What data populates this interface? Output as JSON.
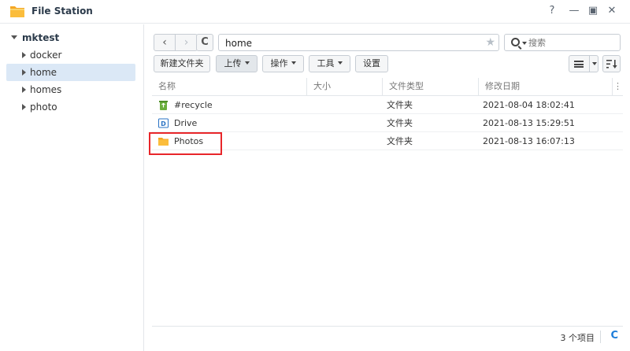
{
  "window": {
    "title": "File Station",
    "controls": [
      "?",
      "—",
      "▣",
      "✕"
    ]
  },
  "sidebar": {
    "root": "mktest",
    "items": [
      {
        "label": "docker",
        "selected": false
      },
      {
        "label": "home",
        "selected": true
      },
      {
        "label": "homes",
        "selected": false
      },
      {
        "label": "photo",
        "selected": false
      }
    ]
  },
  "nav": {
    "back": "‹",
    "forward": "›",
    "refresh": "C",
    "path": "home",
    "star": "★",
    "search_placeholder": "搜索"
  },
  "toolbar": {
    "new_folder": "新建文件夹",
    "upload": "上传",
    "action": "操作",
    "tools": "工具",
    "settings": "设置"
  },
  "table": {
    "columns": [
      "名称",
      "大小",
      "文件类型",
      "修改日期"
    ],
    "more": "⋮",
    "rows": [
      {
        "name": "#recycle",
        "size": "",
        "type": "文件夹",
        "modified": "2021-08-04 18:02:41",
        "icon": "recycle-bin-icon"
      },
      {
        "name": "Drive",
        "size": "",
        "type": "文件夹",
        "modified": "2021-08-13 15:29:51",
        "icon": "drive-folder-icon"
      },
      {
        "name": "Photos",
        "size": "",
        "type": "文件夹",
        "modified": "2021-08-13 16:07:13",
        "icon": "folder-icon"
      }
    ]
  },
  "footer": {
    "count": "3 个项目",
    "refresh": "C"
  },
  "colors": {
    "accent": "#1d7dd9",
    "selected_bg": "#dbe8f6",
    "highlight": "#e8262a",
    "folder": "#f5a623"
  }
}
